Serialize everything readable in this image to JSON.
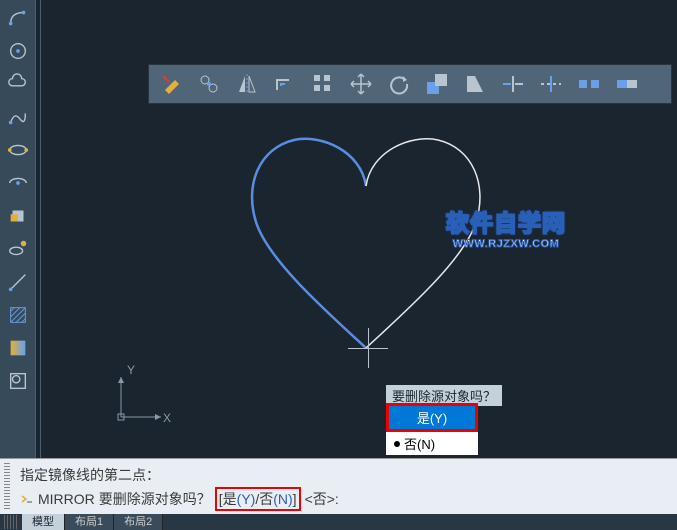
{
  "watermark": {
    "line1": "软件自学网",
    "line2": "WWW.RJZXW.COM"
  },
  "prompt": {
    "question": "要删除源对象吗？",
    "opt_yes": "是(Y)",
    "opt_no": "否(N)"
  },
  "command": {
    "line1": "指定镜像线的第二点：",
    "mirror": "MIRROR",
    "text": "要删除源对象吗？",
    "bracket_open": "[",
    "opt_yes_label": "是",
    "opt_yes_key": "(Y)",
    "slash": "/",
    "opt_no_label": "否",
    "opt_no_key": "(N)",
    "bracket_close": "]",
    "default": "<否>:"
  },
  "tabs": {
    "model": "模型",
    "layout1": "布局1",
    "layout2": "布局2"
  },
  "ucs": {
    "x": "X",
    "y": "Y"
  },
  "colors": {
    "accent": "#0078d7",
    "highlight": "#e00",
    "canvas_bg": "#1a2530"
  }
}
